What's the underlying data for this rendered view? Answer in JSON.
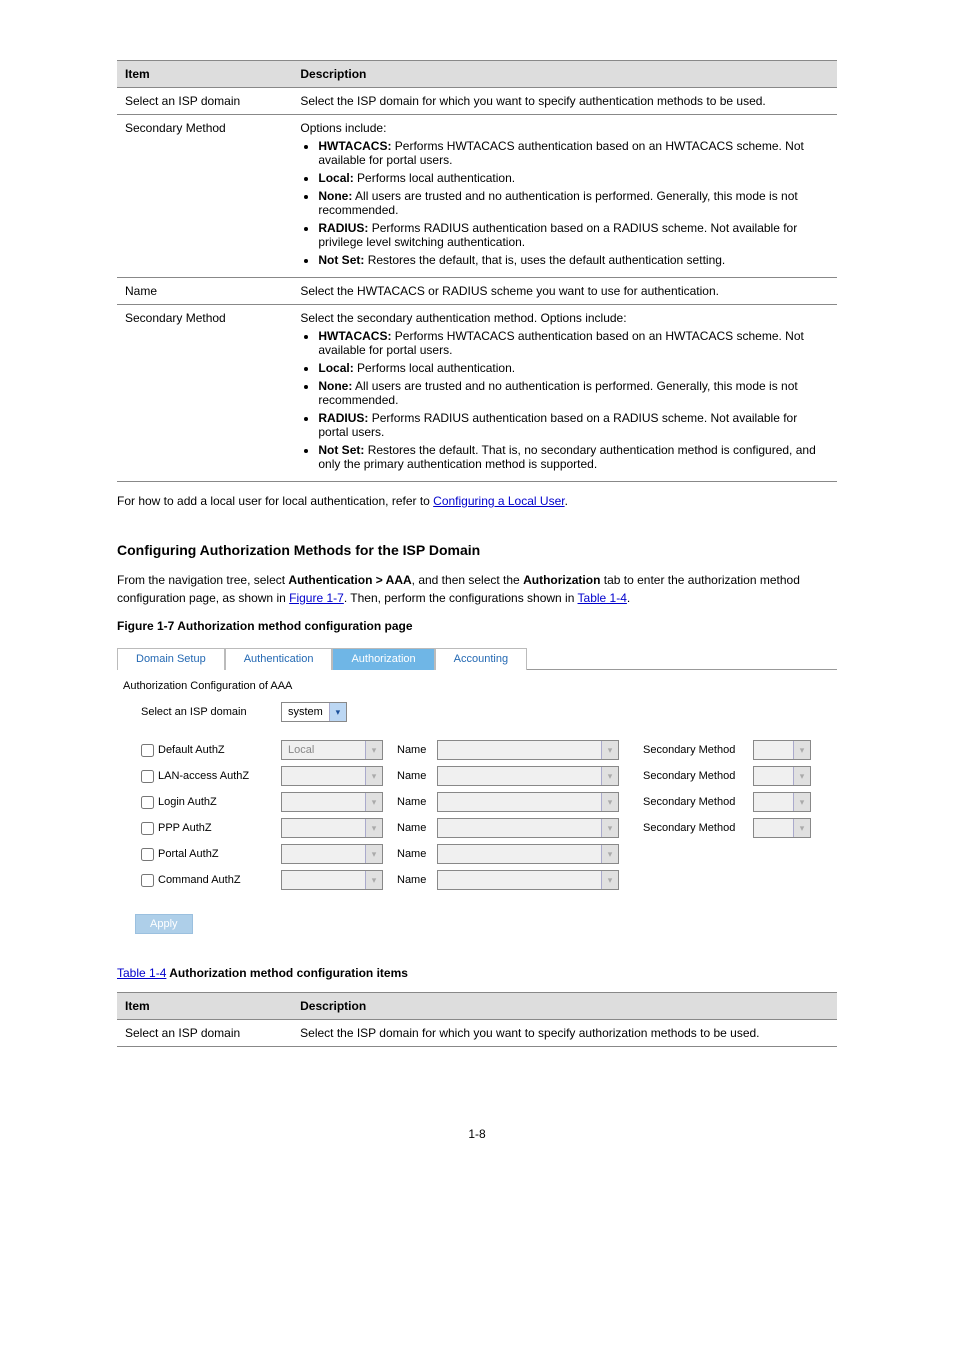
{
  "page_number": "1-8",
  "table1": {
    "headers": [
      "Item",
      "Description"
    ],
    "rows": [
      {
        "item": "Select an ISP domain",
        "desc": "Select the ISP domain for which you want to specify authentication methods to be used."
      },
      {
        "item": "Secondary Method",
        "desc_intro": "Options include:",
        "bullets": [
          "HWTACACS: Performs HWTACACS authentication based on an HWTACACS scheme. Not available for portal users.",
          "Local: Performs local authentication.",
          "None: All users are trusted and no authentication is performed. Generally, this mode is not recommended.",
          "RADIUS: Performs RADIUS authentication based on a RADIUS scheme. Not available for privilege level switching authentication.",
          "Not Set: Restores the default, that is, uses the default authentication setting."
        ]
      },
      {
        "item": "Name",
        "desc": "Select the HWTACACS or RADIUS scheme you want to use for authentication."
      },
      {
        "item": "Secondary Method",
        "desc_intro": "Select the secondary authentication method. Options include:",
        "bullets": [
          "HWTACACS: Performs HWTACACS authentication based on an HWTACACS scheme. Not available for portal users.",
          "Local: Performs local authentication.",
          "None: All users are trusted and no authentication is performed. Generally, this mode is not recommended.",
          "RADIUS: Performs RADIUS authentication based on a RADIUS scheme. Not available for portal users.",
          "Not Set: Restores the default. That is, no secondary authentication method is configured, and only the primary authentication method is supported."
        ]
      }
    ]
  },
  "para_refer_text": "For how to add a local user for local authentication, refer to ",
  "para_refer_link": "Configuring a Local User",
  "para_refer_tail": ".",
  "heading_authz": "Configuring Authorization Methods for the ISP Domain",
  "para2_a": "From the navigation tree, select ",
  "para2_b": "Authentication > AAA",
  "para2_c": ", and then select the ",
  "para2_d": "Authorization",
  "para2_e": " tab to enter the authorization method configuration page, as shown in ",
  "para2_link": "Figure 1-7",
  "para2_tail": ". Then, perform the configurations shown in ",
  "para2_link2": "Table 1-4",
  "para2_tail2": ".",
  "figcap": "Figure 1-7 Authorization method configuration page",
  "ui": {
    "tabs": [
      "Domain Setup",
      "Authentication",
      "Authorization",
      "Accounting"
    ],
    "active_tab": 2,
    "subtitle": "Authorization Configuration of AAA",
    "isp_label": "Select an ISP domain",
    "isp_value": "system",
    "name_label": "Name",
    "sec_label": "Secondary Method",
    "rows": [
      {
        "label": "Default AuthZ",
        "method": "Local",
        "has_sec": true
      },
      {
        "label": "LAN-access AuthZ",
        "method": "",
        "has_sec": true
      },
      {
        "label": "Login AuthZ",
        "method": "",
        "has_sec": true
      },
      {
        "label": "PPP AuthZ",
        "method": "",
        "has_sec": true
      },
      {
        "label": "Portal AuthZ",
        "method": "",
        "has_sec": false
      },
      {
        "label": "Command AuthZ",
        "method": "",
        "has_sec": false
      }
    ],
    "apply": "Apply"
  },
  "table2_cap_link": "Table 1-4",
  "table2_cap_rest": " Authorization method configuration items",
  "table2": {
    "headers": [
      "Item",
      "Description"
    ],
    "rows": [
      {
        "item": "Select an ISP domain",
        "desc": "Select the ISP domain for which you want to specify authorization methods to be used."
      }
    ]
  }
}
